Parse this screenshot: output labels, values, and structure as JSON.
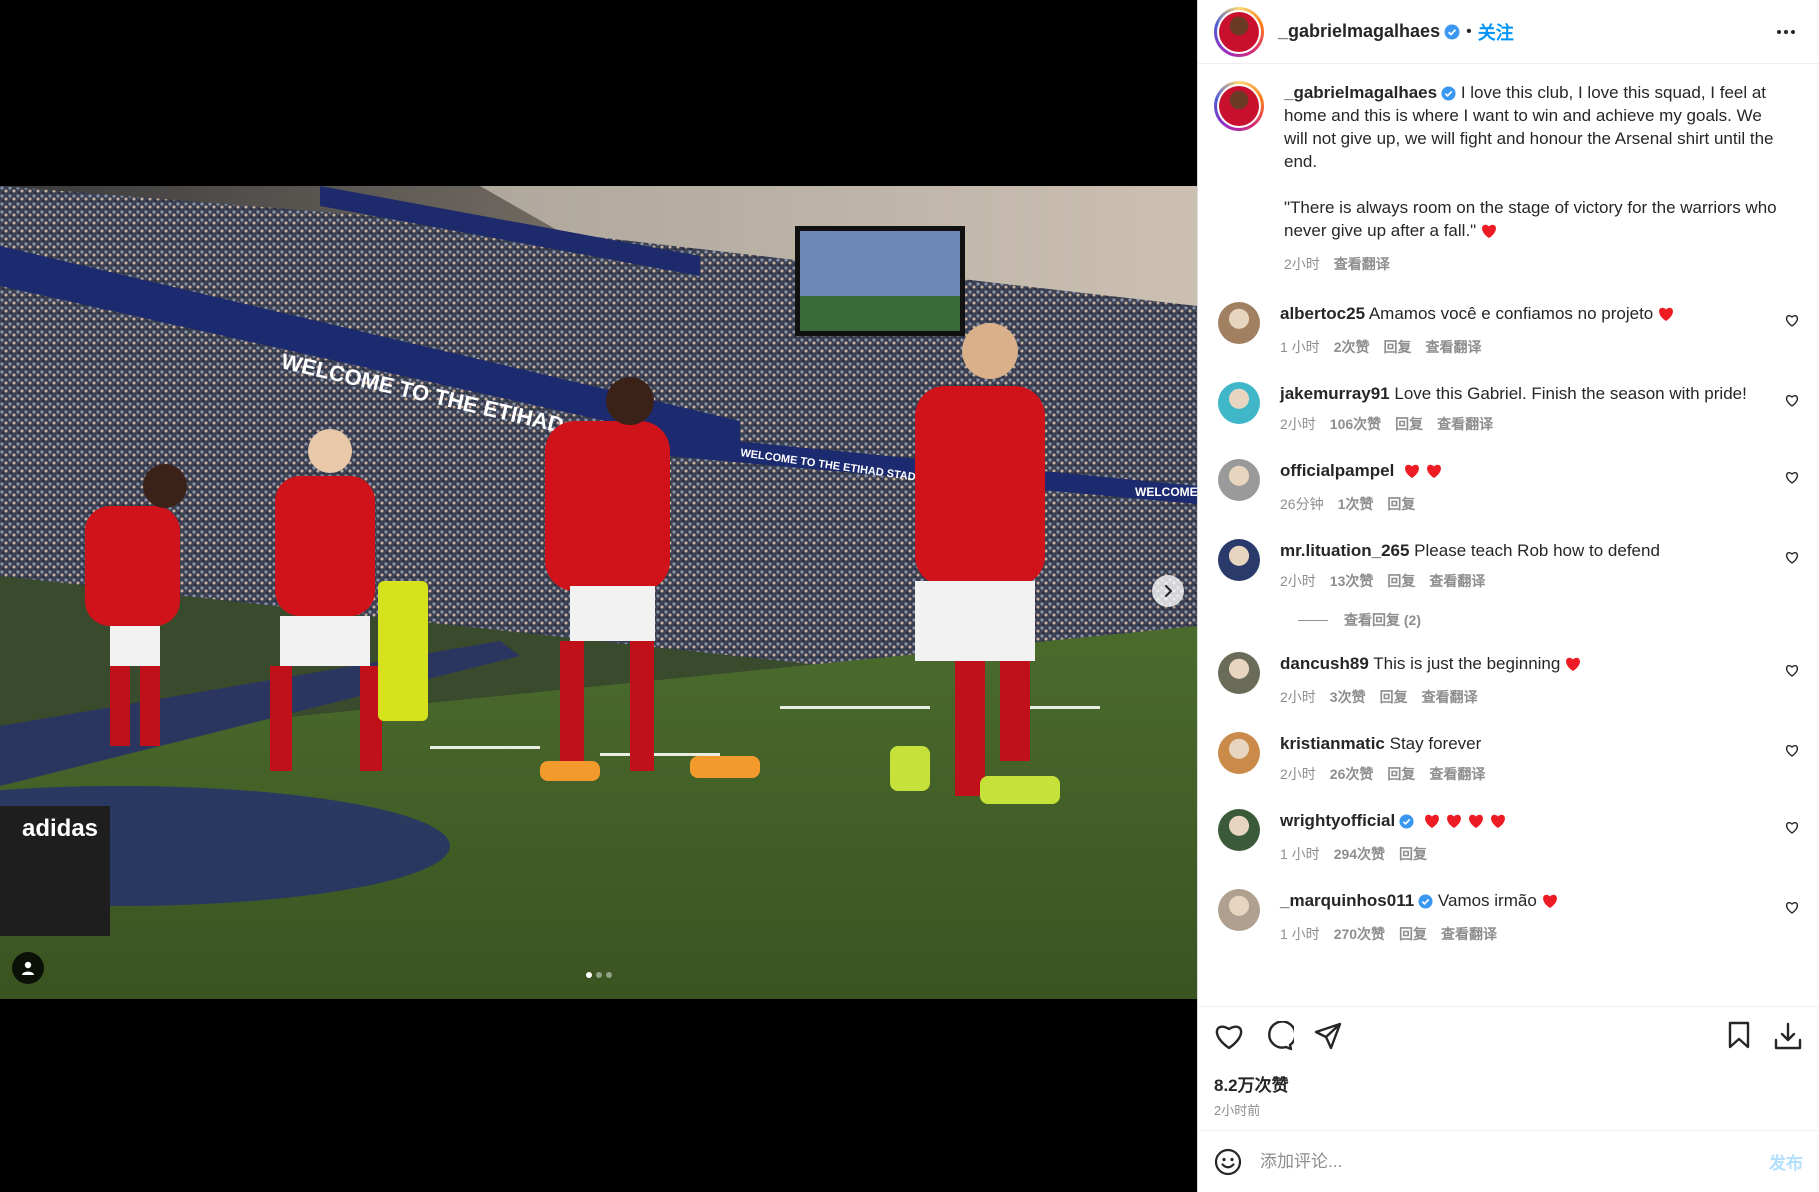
{
  "post": {
    "username": "_gabrielmagalhaes",
    "follow_label": "关注",
    "separator": "•",
    "caption_p1": "I love this club, I love this squad, I feel at home and this is where I want to win and achieve my goals. We will not give up, we will fight and honour the Arsenal shirt until the end.",
    "caption_p2": "\"There is always room on the stage of victory for the warriors who never give up after a fall.\"",
    "caption_time": "2小时",
    "caption_translate": "查看翻译"
  },
  "photo": {
    "banner_text": "WELCOME TO THE ETIHAD STADIUM",
    "banner_text_small": "WELCOME TO THE ETIHAD STADIUM",
    "banner_text_right": "WELCOME TO",
    "adidas": "adidas",
    "carousel_count": 3,
    "carousel_active": 0
  },
  "comments": [
    {
      "user": "albertoc25",
      "verified": false,
      "text": "Amamos você e confiamos no projeto",
      "hearts": 1,
      "time": "1 小时",
      "likes": "2次赞",
      "reply": "回复",
      "translate": "查看翻译",
      "avatar_color": "#a08060"
    },
    {
      "user": "jakemurray91",
      "verified": false,
      "text": "Love this Gabriel. Finish the season with pride!",
      "hearts": 0,
      "time": "2小时",
      "likes": "106次赞",
      "reply": "回复",
      "translate": "查看翻译",
      "avatar_color": "#3fb7c9"
    },
    {
      "user": "officialpampel",
      "verified": false,
      "text": "",
      "hearts": 2,
      "time": "26分钟",
      "likes": "1次赞",
      "reply": "回复",
      "translate": "",
      "avatar_color": "#9a9a9a"
    },
    {
      "user": "mr.lituation_265",
      "verified": false,
      "text": "Please teach Rob how to defend",
      "hearts": 0,
      "time": "2小时",
      "likes": "13次赞",
      "reply": "回复",
      "translate": "查看翻译",
      "avatar_color": "#2a3a6a",
      "view_replies": "查看回复 (2)"
    },
    {
      "user": "dancush89",
      "verified": false,
      "text": "This is just the beginning",
      "hearts": 1,
      "time": "2小时",
      "likes": "3次赞",
      "reply": "回复",
      "translate": "查看翻译",
      "avatar_color": "#6b6b5a"
    },
    {
      "user": "kristianmatic",
      "verified": false,
      "text": "Stay forever",
      "hearts": 0,
      "time": "2小时",
      "likes": "26次赞",
      "reply": "回复",
      "translate": "查看翻译",
      "avatar_color": "#c98a4a"
    },
    {
      "user": "wrightyofficial",
      "verified": true,
      "text": "",
      "hearts": 4,
      "time": "1 小时",
      "likes": "294次赞",
      "reply": "回复",
      "translate": "",
      "avatar_color": "#3a5a3a"
    },
    {
      "user": "_marquinhos011",
      "verified": true,
      "text": "Vamos irmão",
      "hearts": 1,
      "time": "1 小时",
      "likes": "270次赞",
      "reply": "回复",
      "translate": "查看翻译",
      "avatar_color": "#b0a090"
    }
  ],
  "actions": {
    "likes_count": "8.2万次赞",
    "post_time": "2小时前"
  },
  "comment_input": {
    "placeholder": "添加评论...",
    "post_label": "发布"
  },
  "colors": {
    "accent": "#0095f6",
    "heart": "#ed1c24",
    "verified": "#3897f0",
    "arsenal_red": "#d0121b"
  }
}
